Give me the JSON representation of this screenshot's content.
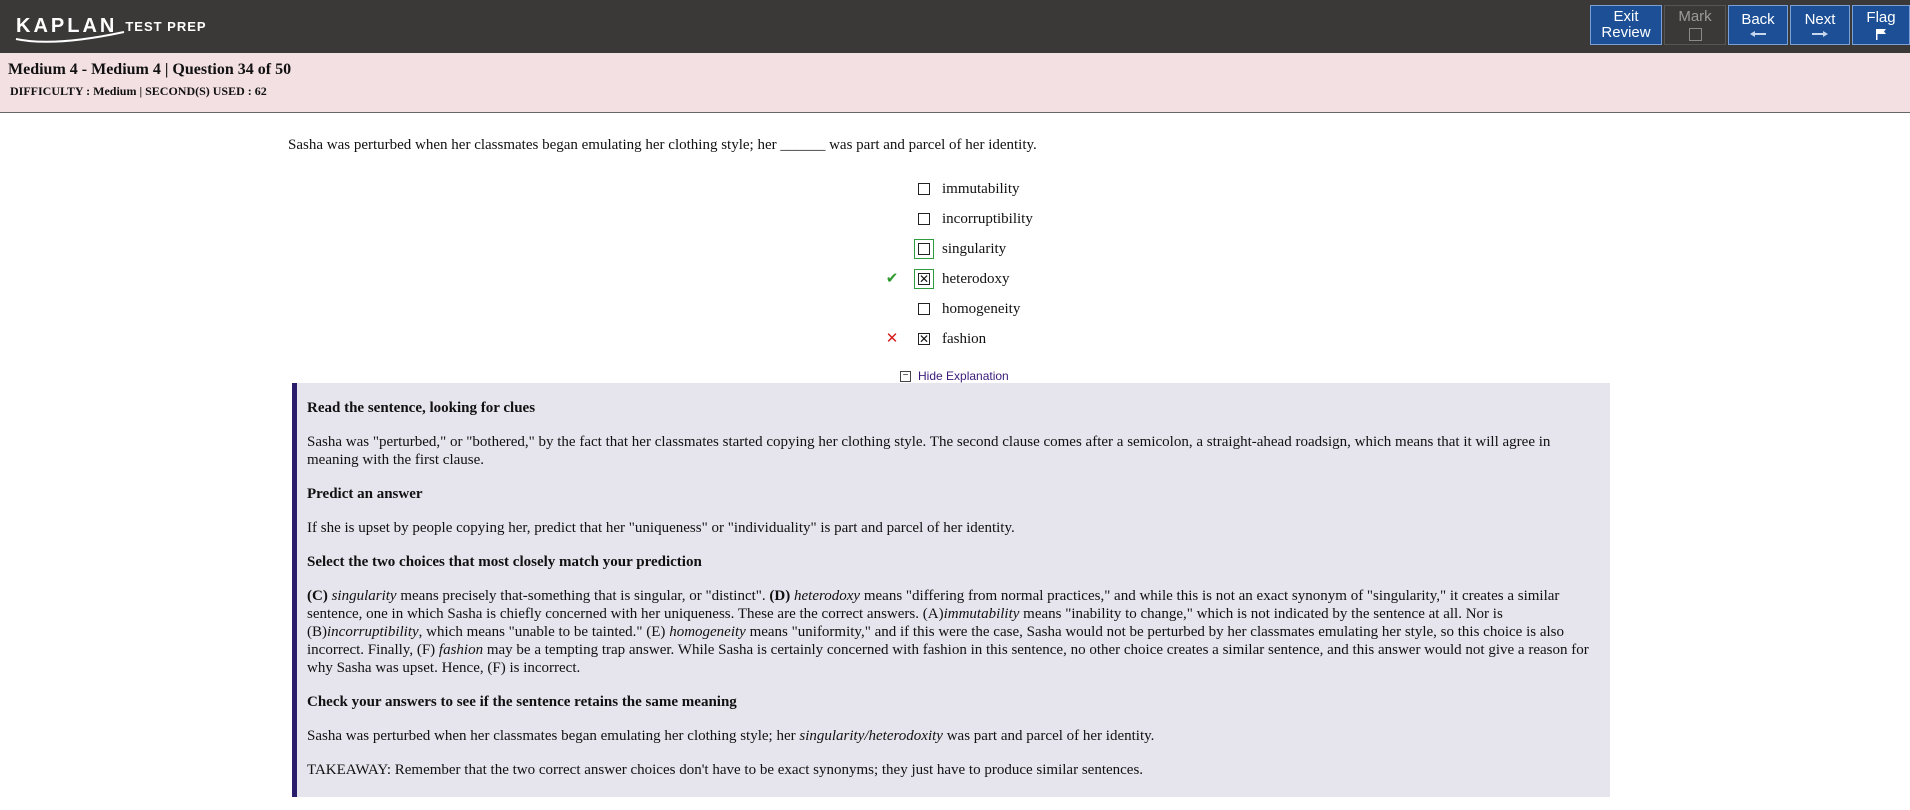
{
  "header": {
    "logo_word": "KAPLAN",
    "logo_sub": "TEST PREP",
    "buttons": {
      "exit_line1": "Exit",
      "exit_line2": "Review",
      "mark": "Mark",
      "back": "Back",
      "next": "Next",
      "flag": "Flag"
    }
  },
  "info": {
    "title": "Medium 4 - Medium 4 | Question  34 of 50",
    "difficulty": "DIFFICULTY : Medium | SECOND(S) USED : 62"
  },
  "question": {
    "text": "Sasha was perturbed when her classmates began emulating her clothing style; her ______ was part and parcel of her identity."
  },
  "choices": [
    {
      "label": "immutability",
      "checked": false,
      "result": ""
    },
    {
      "label": "incorruptibility",
      "checked": false,
      "result": ""
    },
    {
      "label": "singularity",
      "checked": false,
      "result": ""
    },
    {
      "label": "heterodoxy",
      "checked": true,
      "result": "correct"
    },
    {
      "label": "homogeneity",
      "checked": false,
      "result": ""
    },
    {
      "label": "fashion",
      "checked": true,
      "result": "incorrect"
    }
  ],
  "hide_explanation": "Hide Explanation",
  "explanation": {
    "h1": "Read the sentence, looking for clues",
    "p1": "Sasha was \"perturbed,\" or \"bothered,\" by the fact that her classmates started copying her clothing style. The second clause comes after a semicolon, a straight-ahead roadsign, which means that it will agree in meaning with the first clause.",
    "h2": "Predict an answer",
    "p2": "If she is upset by people copying her, predict that her \"uniqueness\" or \"individuality\" is part and parcel of her identity.",
    "h3": "Select the two choices that most closely match your prediction",
    "p3": {
      "c_tag": "(C)",
      "c_word": "singularity",
      "c_text": " means precisely that-something that is singular, or \"distinct\". ",
      "d_tag": "(D)",
      "d_word": "heterodoxy",
      "d_text": " means \"differing from normal practices,\" and while this is not an exact synonym of \"singularity,\" it creates a similar sentence, one in which Sasha is chiefly concerned with her uniqueness. These are the correct answers. (A)",
      "a_word": "immutability",
      "a_text": " means \"inability to change,\" which is not indicated by the sentence at all. Nor is (B)",
      "b_word": "incorruptibility",
      "b_text": ", which means \"unable to be tainted.\" (E) ",
      "e_word": "homogeneity",
      "e_text": " means \"uniformity,\" and if this were the case, Sasha would not be perturbed by her classmates emulating her style, so this choice is also incorrect. Finally, (F) ",
      "f_word": "fashion",
      "f_text": " may be a tempting trap answer. While Sasha is certainly concerned with fashion in this sentence, no other choice creates a similar sentence, and this answer would not give a reason for why Sasha was upset. Hence, (F) is incorrect."
    },
    "h4": "Check your answers to see if the sentence retains the same meaning",
    "p4": {
      "pre": "Sasha was perturbed when her classmates began emulating her clothing style; her ",
      "answer": "singularity/heterodoxity",
      "post": " was part and parcel of her identity."
    },
    "takeaway": "TAKEAWAY: Remember that the two correct answer choices don't have to be exact synonyms; they just have to produce similar sentences."
  },
  "colors": {
    "topbar": "#3b3838",
    "button": "#1c4f96",
    "infobar": "#f3e0e3",
    "explanation_bg": "#e6e5ee",
    "explanation_border": "#2b1b6b",
    "correct": "#2d9a2d",
    "incorrect": "#d62020"
  },
  "icons": {
    "back_arrow": "arrow-left-icon",
    "next_arrow": "arrow-right-icon",
    "flag": "flag-icon",
    "correct": "checkmark-icon",
    "incorrect": "x-mark-icon"
  }
}
